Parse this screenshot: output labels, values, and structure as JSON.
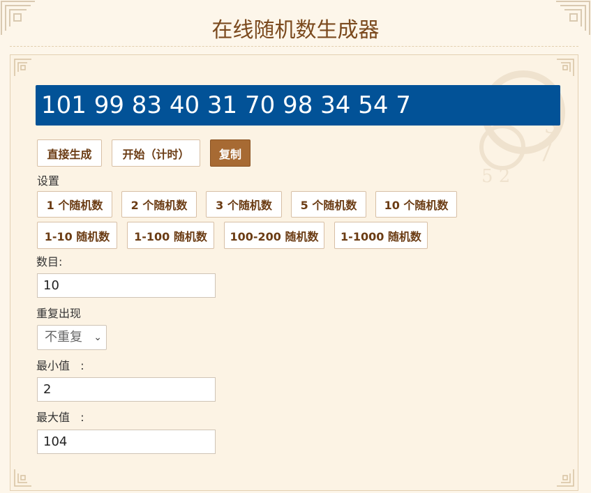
{
  "page": {
    "title": "在线随机数生成器"
  },
  "result": {
    "text": "101 99 83 40 31 70 98 34 54 7"
  },
  "actions": {
    "generate": "直接生成",
    "start_timer": "开始（计时）",
    "copy": "复制"
  },
  "settings": {
    "label": "设置",
    "count_presets": [
      "1 个随机数",
      "2 个随机数",
      "3 个随机数",
      "5 个随机数",
      "10 个随机数"
    ],
    "range_presets": [
      "1-10 随机数",
      "1-100 随机数",
      "100-200 随机数",
      "1-1000 随机数"
    ]
  },
  "form": {
    "count_label": "数目:",
    "count_value": "10",
    "repeat_label": "重复出现",
    "repeat_value": "不重复",
    "min_label": "最小值   :",
    "min_value": "2",
    "max_label": "最大值   :",
    "max_value": "104"
  },
  "colors": {
    "background": "#fdf6ea",
    "accent": "#a76a33",
    "result_bg": "#025297",
    "title": "#7b4a1e"
  }
}
